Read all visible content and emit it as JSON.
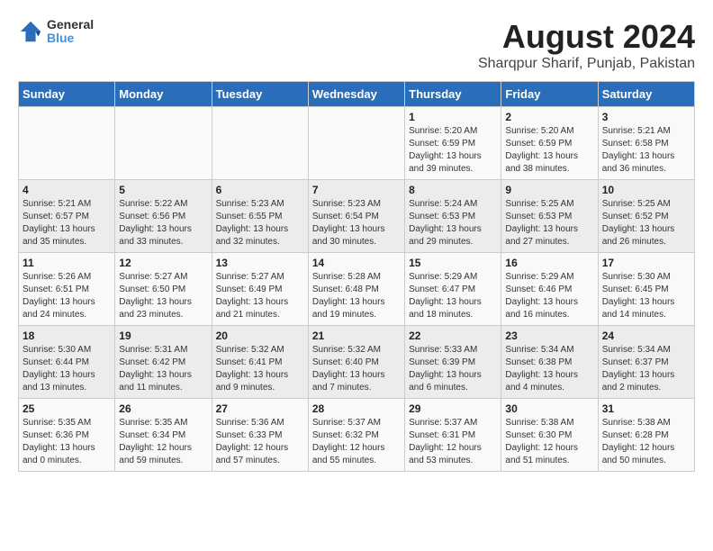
{
  "header": {
    "logo_line1": "General",
    "logo_line2": "Blue",
    "title": "August 2024",
    "subtitle": "Sharqpur Sharif, Punjab, Pakistan"
  },
  "days_of_week": [
    "Sunday",
    "Monday",
    "Tuesday",
    "Wednesday",
    "Thursday",
    "Friday",
    "Saturday"
  ],
  "weeks": [
    [
      {
        "day": "",
        "sunrise": "",
        "sunset": "",
        "daylight": ""
      },
      {
        "day": "",
        "sunrise": "",
        "sunset": "",
        "daylight": ""
      },
      {
        "day": "",
        "sunrise": "",
        "sunset": "",
        "daylight": ""
      },
      {
        "day": "",
        "sunrise": "",
        "sunset": "",
        "daylight": ""
      },
      {
        "day": "1",
        "sunrise": "Sunrise: 5:20 AM",
        "sunset": "Sunset: 6:59 PM",
        "daylight": "Daylight: 13 hours and 39 minutes."
      },
      {
        "day": "2",
        "sunrise": "Sunrise: 5:20 AM",
        "sunset": "Sunset: 6:59 PM",
        "daylight": "Daylight: 13 hours and 38 minutes."
      },
      {
        "day": "3",
        "sunrise": "Sunrise: 5:21 AM",
        "sunset": "Sunset: 6:58 PM",
        "daylight": "Daylight: 13 hours and 36 minutes."
      }
    ],
    [
      {
        "day": "4",
        "sunrise": "Sunrise: 5:21 AM",
        "sunset": "Sunset: 6:57 PM",
        "daylight": "Daylight: 13 hours and 35 minutes."
      },
      {
        "day": "5",
        "sunrise": "Sunrise: 5:22 AM",
        "sunset": "Sunset: 6:56 PM",
        "daylight": "Daylight: 13 hours and 33 minutes."
      },
      {
        "day": "6",
        "sunrise": "Sunrise: 5:23 AM",
        "sunset": "Sunset: 6:55 PM",
        "daylight": "Daylight: 13 hours and 32 minutes."
      },
      {
        "day": "7",
        "sunrise": "Sunrise: 5:23 AM",
        "sunset": "Sunset: 6:54 PM",
        "daylight": "Daylight: 13 hours and 30 minutes."
      },
      {
        "day": "8",
        "sunrise": "Sunrise: 5:24 AM",
        "sunset": "Sunset: 6:53 PM",
        "daylight": "Daylight: 13 hours and 29 minutes."
      },
      {
        "day": "9",
        "sunrise": "Sunrise: 5:25 AM",
        "sunset": "Sunset: 6:53 PM",
        "daylight": "Daylight: 13 hours and 27 minutes."
      },
      {
        "day": "10",
        "sunrise": "Sunrise: 5:25 AM",
        "sunset": "Sunset: 6:52 PM",
        "daylight": "Daylight: 13 hours and 26 minutes."
      }
    ],
    [
      {
        "day": "11",
        "sunrise": "Sunrise: 5:26 AM",
        "sunset": "Sunset: 6:51 PM",
        "daylight": "Daylight: 13 hours and 24 minutes."
      },
      {
        "day": "12",
        "sunrise": "Sunrise: 5:27 AM",
        "sunset": "Sunset: 6:50 PM",
        "daylight": "Daylight: 13 hours and 23 minutes."
      },
      {
        "day": "13",
        "sunrise": "Sunrise: 5:27 AM",
        "sunset": "Sunset: 6:49 PM",
        "daylight": "Daylight: 13 hours and 21 minutes."
      },
      {
        "day": "14",
        "sunrise": "Sunrise: 5:28 AM",
        "sunset": "Sunset: 6:48 PM",
        "daylight": "Daylight: 13 hours and 19 minutes."
      },
      {
        "day": "15",
        "sunrise": "Sunrise: 5:29 AM",
        "sunset": "Sunset: 6:47 PM",
        "daylight": "Daylight: 13 hours and 18 minutes."
      },
      {
        "day": "16",
        "sunrise": "Sunrise: 5:29 AM",
        "sunset": "Sunset: 6:46 PM",
        "daylight": "Daylight: 13 hours and 16 minutes."
      },
      {
        "day": "17",
        "sunrise": "Sunrise: 5:30 AM",
        "sunset": "Sunset: 6:45 PM",
        "daylight": "Daylight: 13 hours and 14 minutes."
      }
    ],
    [
      {
        "day": "18",
        "sunrise": "Sunrise: 5:30 AM",
        "sunset": "Sunset: 6:44 PM",
        "daylight": "Daylight: 13 hours and 13 minutes."
      },
      {
        "day": "19",
        "sunrise": "Sunrise: 5:31 AM",
        "sunset": "Sunset: 6:42 PM",
        "daylight": "Daylight: 13 hours and 11 minutes."
      },
      {
        "day": "20",
        "sunrise": "Sunrise: 5:32 AM",
        "sunset": "Sunset: 6:41 PM",
        "daylight": "Daylight: 13 hours and 9 minutes."
      },
      {
        "day": "21",
        "sunrise": "Sunrise: 5:32 AM",
        "sunset": "Sunset: 6:40 PM",
        "daylight": "Daylight: 13 hours and 7 minutes."
      },
      {
        "day": "22",
        "sunrise": "Sunrise: 5:33 AM",
        "sunset": "Sunset: 6:39 PM",
        "daylight": "Daylight: 13 hours and 6 minutes."
      },
      {
        "day": "23",
        "sunrise": "Sunrise: 5:34 AM",
        "sunset": "Sunset: 6:38 PM",
        "daylight": "Daylight: 13 hours and 4 minutes."
      },
      {
        "day": "24",
        "sunrise": "Sunrise: 5:34 AM",
        "sunset": "Sunset: 6:37 PM",
        "daylight": "Daylight: 13 hours and 2 minutes."
      }
    ],
    [
      {
        "day": "25",
        "sunrise": "Sunrise: 5:35 AM",
        "sunset": "Sunset: 6:36 PM",
        "daylight": "Daylight: 13 hours and 0 minutes."
      },
      {
        "day": "26",
        "sunrise": "Sunrise: 5:35 AM",
        "sunset": "Sunset: 6:34 PM",
        "daylight": "Daylight: 12 hours and 59 minutes."
      },
      {
        "day": "27",
        "sunrise": "Sunrise: 5:36 AM",
        "sunset": "Sunset: 6:33 PM",
        "daylight": "Daylight: 12 hours and 57 minutes."
      },
      {
        "day": "28",
        "sunrise": "Sunrise: 5:37 AM",
        "sunset": "Sunset: 6:32 PM",
        "daylight": "Daylight: 12 hours and 55 minutes."
      },
      {
        "day": "29",
        "sunrise": "Sunrise: 5:37 AM",
        "sunset": "Sunset: 6:31 PM",
        "daylight": "Daylight: 12 hours and 53 minutes."
      },
      {
        "day": "30",
        "sunrise": "Sunrise: 5:38 AM",
        "sunset": "Sunset: 6:30 PM",
        "daylight": "Daylight: 12 hours and 51 minutes."
      },
      {
        "day": "31",
        "sunrise": "Sunrise: 5:38 AM",
        "sunset": "Sunset: 6:28 PM",
        "daylight": "Daylight: 12 hours and 50 minutes."
      }
    ]
  ]
}
